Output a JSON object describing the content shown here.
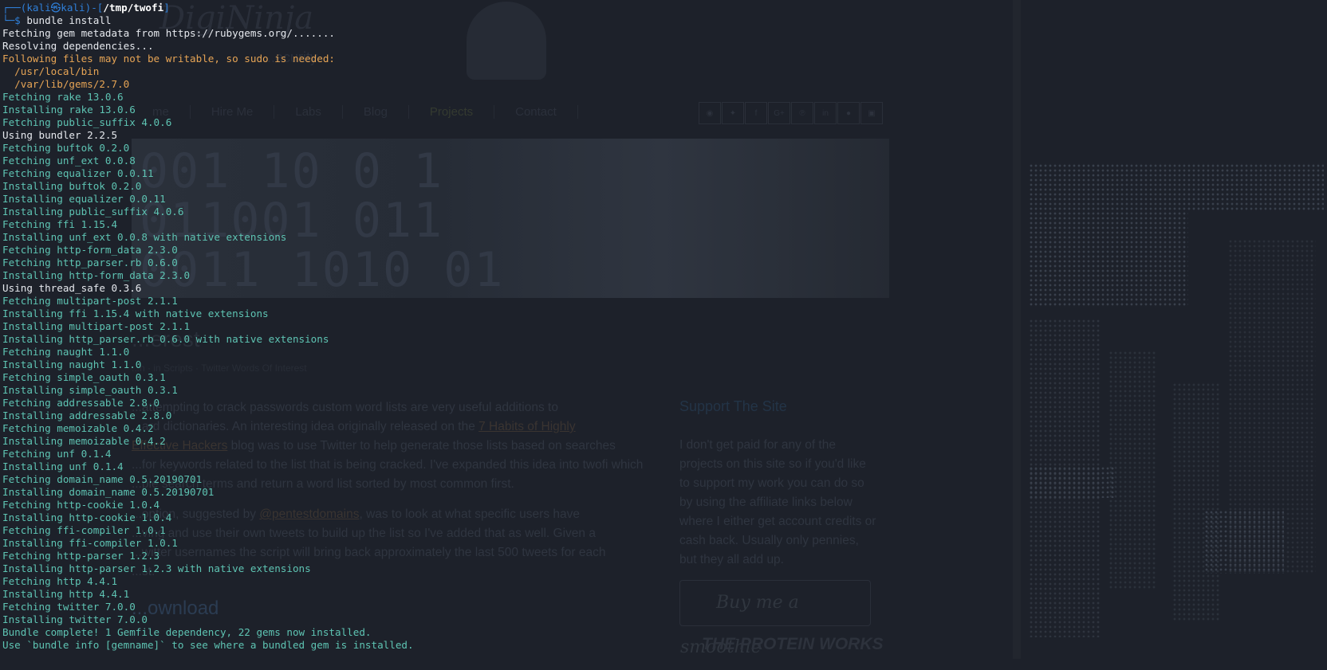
{
  "background_site": {
    "logo_text": "DigiNinja",
    "tagline": "...ecurity",
    "nav": [
      "me",
      "Hire Me",
      "Labs",
      "Blog",
      "Projects",
      "Contact"
    ],
    "social_icons": [
      "rss-icon",
      "twitter-icon",
      "facebook-icon",
      "google-plus-icon",
      "pinterest-icon",
      "linkedin-icon",
      "reddit-icon",
      "other-icon"
    ],
    "banner_code": "001 10 0 1\n011001 011\n0011 1010 01",
    "heading": "...erest",
    "meta": "...h · in Scripts · Twitter Words Of Interest",
    "body_p1_a": "...attempting to crack passwords custom word lists are very useful additions to",
    "body_p1_b": "...ard dictionaries. An interesting idea originally released on the ",
    "body_p1_link1": "7 Habits of Highly",
    "body_p1_c": "Effective Hackers",
    "body_p1_d": " blog was to use Twitter to help generate those lists based on searches",
    "body_p1_e": "...for keywords related to the list that is being cracked. I've expanded this idea into twofi which",
    "body_p1_f": "...ple search terms and return a word list sorted by most common first.",
    "body_p2_a": "...option, suggested by ",
    "body_p2_link": "@pentestdomains",
    "body_p2_b": ", was to look at what specific users have",
    "body_p2_c": "...ving and use their own tweets to build up the list so I've added that as well. Given a",
    "body_p2_d": "...witter usernames the script will bring back approximately the last 500 tweets for each",
    "body_p2_e": "...st.",
    "download_heading": "...ownload",
    "sidebar_title": "Support The Site",
    "sidebar_text": "I don't get paid for any of the projects on this site so if you'd like to support my work you can do so by using the affiliate links below where I either get account credits or cash back. Usually only pennies, but they all add up.",
    "smoothie_label": "Buy me a smoothie",
    "protein_label": "THE PROTEIN WORKS"
  },
  "terminal": {
    "prompt": {
      "deco_top": "┌──(",
      "user": "kali㉿kali",
      "mid": ")-[",
      "path": "/tmp/twofi",
      "end": "]",
      "deco_bottom": "└─",
      "dollar": "$ ",
      "command": "bundle install"
    },
    "lines": [
      {
        "text": "Fetching gem metadata from https://rubygems.org/.......",
        "style": "white"
      },
      {
        "text": "Resolving dependencies...",
        "style": "white"
      },
      {
        "text": "Following files may not be writable, so sudo is needed:",
        "style": "orange"
      },
      {
        "text": "  /usr/local/bin",
        "style": "orange"
      },
      {
        "text": "  /var/lib/gems/2.7.0",
        "style": "orange"
      },
      {
        "text": "Fetching rake 13.0.6",
        "style": "teal"
      },
      {
        "text": "Installing rake 13.0.6",
        "style": "teal"
      },
      {
        "text": "Fetching public_suffix 4.0.6",
        "style": "teal"
      },
      {
        "text": "Using bundler 2.2.5",
        "style": "white"
      },
      {
        "text": "Fetching buftok 0.2.0",
        "style": "teal"
      },
      {
        "text": "Fetching unf_ext 0.0.8",
        "style": "teal"
      },
      {
        "text": "Fetching equalizer 0.0.11",
        "style": "teal"
      },
      {
        "text": "Installing buftok 0.2.0",
        "style": "teal"
      },
      {
        "text": "Installing equalizer 0.0.11",
        "style": "teal"
      },
      {
        "text": "Installing public_suffix 4.0.6",
        "style": "teal"
      },
      {
        "text": "Fetching ffi 1.15.4",
        "style": "teal"
      },
      {
        "text": "Installing unf_ext 0.0.8 with native extensions",
        "style": "teal"
      },
      {
        "text": "Fetching http-form_data 2.3.0",
        "style": "teal"
      },
      {
        "text": "Fetching http_parser.rb 0.6.0",
        "style": "teal"
      },
      {
        "text": "Installing http-form_data 2.3.0",
        "style": "teal"
      },
      {
        "text": "Using thread_safe 0.3.6",
        "style": "white"
      },
      {
        "text": "Fetching multipart-post 2.1.1",
        "style": "teal"
      },
      {
        "text": "Installing ffi 1.15.4 with native extensions",
        "style": "teal"
      },
      {
        "text": "Installing multipart-post 2.1.1",
        "style": "teal"
      },
      {
        "text": "Installing http_parser.rb 0.6.0 with native extensions",
        "style": "teal"
      },
      {
        "text": "Fetching naught 1.1.0",
        "style": "teal"
      },
      {
        "text": "Installing naught 1.1.0",
        "style": "teal"
      },
      {
        "text": "Fetching simple_oauth 0.3.1",
        "style": "teal"
      },
      {
        "text": "Installing simple_oauth 0.3.1",
        "style": "teal"
      },
      {
        "text": "Fetching addressable 2.8.0",
        "style": "teal"
      },
      {
        "text": "Installing addressable 2.8.0",
        "style": "teal"
      },
      {
        "text": "Fetching memoizable 0.4.2",
        "style": "teal"
      },
      {
        "text": "Installing memoizable 0.4.2",
        "style": "teal"
      },
      {
        "text": "Fetching unf 0.1.4",
        "style": "teal"
      },
      {
        "text": "Installing unf 0.1.4",
        "style": "teal"
      },
      {
        "text": "Fetching domain_name 0.5.20190701",
        "style": "teal"
      },
      {
        "text": "Installing domain_name 0.5.20190701",
        "style": "teal"
      },
      {
        "text": "Fetching http-cookie 1.0.4",
        "style": "teal"
      },
      {
        "text": "Installing http-cookie 1.0.4",
        "style": "teal"
      },
      {
        "text": "Fetching ffi-compiler 1.0.1",
        "style": "teal"
      },
      {
        "text": "Installing ffi-compiler 1.0.1",
        "style": "teal"
      },
      {
        "text": "Fetching http-parser 1.2.3",
        "style": "teal"
      },
      {
        "text": "Installing http-parser 1.2.3 with native extensions",
        "style": "teal"
      },
      {
        "text": "Fetching http 4.4.1",
        "style": "teal"
      },
      {
        "text": "Installing http 4.4.1",
        "style": "teal"
      },
      {
        "text": "Fetching twitter 7.0.0",
        "style": "teal"
      },
      {
        "text": "Installing twitter 7.0.0",
        "style": "teal"
      },
      {
        "text": "Bundle complete! 1 Gemfile dependency, 22 gems now installed.",
        "style": "teal"
      },
      {
        "text": "Use `bundle info [gemname]` to see where a bundled gem is installed.",
        "style": "teal"
      }
    ]
  },
  "colors": {
    "background": "#1d212a",
    "teal": "#5ec4b3",
    "white": "#e6e9ee",
    "orange": "#e6a455",
    "prompt_blue": "#2f7fd8"
  }
}
